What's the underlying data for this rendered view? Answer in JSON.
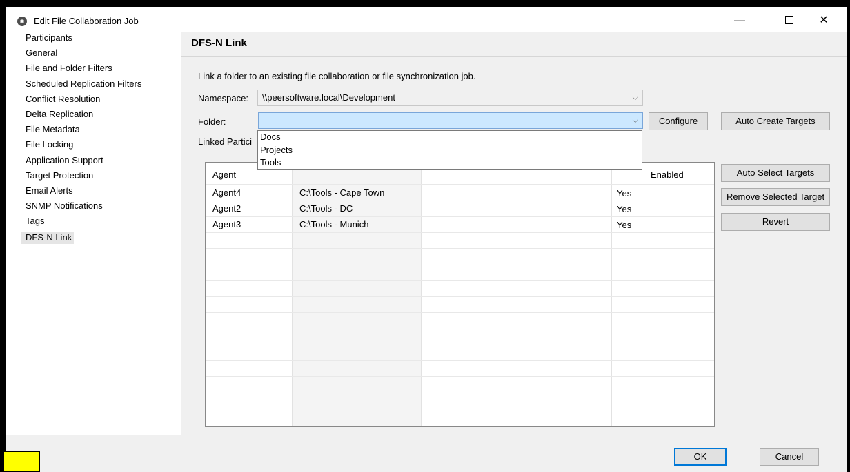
{
  "window": {
    "title": "Edit File Collaboration Job",
    "minimize": "—",
    "close": "✕"
  },
  "sidebar": {
    "items": [
      {
        "label": "Participants"
      },
      {
        "label": "General"
      },
      {
        "label": "File and Folder Filters"
      },
      {
        "label": "Scheduled Replication Filters"
      },
      {
        "label": "Conflict Resolution"
      },
      {
        "label": "Delta Replication"
      },
      {
        "label": "File Metadata"
      },
      {
        "label": "File Locking"
      },
      {
        "label": "Application Support"
      },
      {
        "label": "Target Protection"
      },
      {
        "label": "Email Alerts"
      },
      {
        "label": "SNMP Notifications"
      },
      {
        "label": "Tags"
      },
      {
        "label": "DFS-N Link"
      }
    ],
    "selected": "DFS-N Link"
  },
  "page": {
    "title": "DFS-N Link",
    "description": "Link a folder to an existing file collaboration or file synchronization job.",
    "namespace_label": "Namespace:",
    "namespace_value": "\\\\peersoftware.local\\Development",
    "folder_label": "Folder:",
    "folder_value": "",
    "linked_label": "Linked Partici",
    "chevron": "⌵"
  },
  "folder_options": [
    "Docs",
    "Projects",
    "Tools"
  ],
  "buttons": {
    "configure": "Configure",
    "auto_create": "Auto Create Targets",
    "auto_select": "Auto Select Targets",
    "remove_selected": "Remove Selected Target",
    "revert": "Revert",
    "ok": "OK",
    "cancel": "Cancel"
  },
  "table": {
    "headers": {
      "agent": "Agent",
      "enabled": "Enabled"
    },
    "rows": [
      {
        "agent": "Agent4",
        "path": "C:\\Tools - Cape Town",
        "enabled": "Yes"
      },
      {
        "agent": "Agent2",
        "path": "C:\\Tools - DC",
        "enabled": "Yes"
      },
      {
        "agent": "Agent3",
        "path": "C:\\Tools - Munich",
        "enabled": "Yes"
      }
    ]
  },
  "colors": {
    "accent": "#0078d7",
    "selection_highlight": "#cce8ff",
    "panel_background": "#f0f0f0",
    "annotation_yellow": "#ffff00"
  },
  "icons": {
    "app": "peer-software-logo-icon",
    "dropdown": "chevron-down-icon"
  }
}
